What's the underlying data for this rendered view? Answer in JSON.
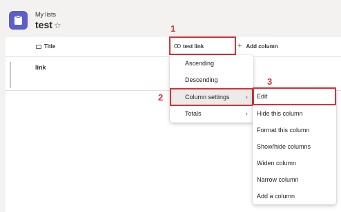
{
  "header": {
    "breadcrumb": "My lists",
    "title": "test",
    "favorite_icon": "star-icon"
  },
  "list": {
    "columns": {
      "title": "Title",
      "link": "test link",
      "add_column": "Add column"
    },
    "rows": [
      {
        "title": "link"
      }
    ]
  },
  "column_menu": {
    "items": [
      "Ascending",
      "Descending",
      "Column settings",
      "Totals"
    ],
    "active_index": 2,
    "submenu_indices": [
      2,
      3
    ]
  },
  "column_settings_submenu": {
    "items": [
      "Edit",
      "Hide this column",
      "Format this column",
      "Show/hide columns",
      "Widen column",
      "Narrow column",
      "Add a column"
    ]
  },
  "annotations": {
    "step1": "1",
    "step2": "2",
    "step3": "3",
    "color": "#d13438"
  },
  "colors": {
    "app_icon": "#5b5fc7",
    "background": "#f3f2f1",
    "menu_active": "#edebe9"
  }
}
